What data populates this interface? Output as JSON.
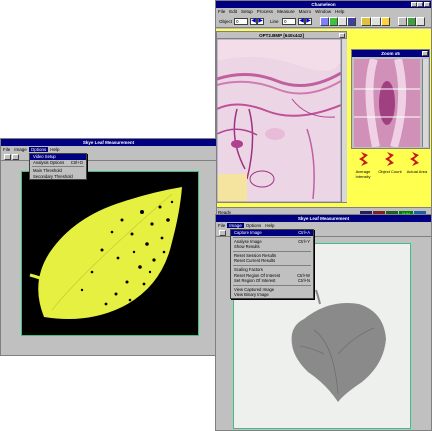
{
  "chameleon": {
    "title": "Chameleon",
    "menu": [
      "File",
      "Edit",
      "Setup",
      "Process",
      "Measure",
      "Macro",
      "Window",
      "Help"
    ],
    "toolbar": {
      "object_label": "Object",
      "object_value": "0",
      "line_label": "Line",
      "line_value": "0"
    },
    "image_window": {
      "title": "OPT2.BMP [640x442]"
    },
    "zoom_window": {
      "title": "Zoom x5"
    },
    "measures": [
      "Average Intensity",
      "Object Count",
      "Actual Area"
    ],
    "status": {
      "text": "Ready",
      "num": "NUM"
    }
  },
  "leaf_left": {
    "title": "Skye Leaf Measurement",
    "menu": [
      "File",
      "Image",
      "Options",
      "Help"
    ],
    "selected_menu": "Options",
    "options_menu": [
      {
        "label": "Video Setup",
        "shortcut": "",
        "selected": true
      },
      {
        "label": "Analysis Options",
        "shortcut": "Ctrl+O",
        "selected": false
      },
      {
        "sep": true
      },
      {
        "label": "Main Threshold",
        "shortcut": "",
        "selected": false
      },
      {
        "label": "Secondary Threshold",
        "shortcut": "",
        "selected": false
      }
    ]
  },
  "leaf_right": {
    "title": "Skye Leaf Measurement",
    "menu": [
      "File",
      "Image",
      "Options",
      "Help"
    ],
    "selected_menu": "Image",
    "image_menu": [
      {
        "label": "Capture Image",
        "shortcut": "Ctrl+A",
        "selected": true
      },
      {
        "sep": true
      },
      {
        "label": "Analyse Image",
        "shortcut": "Ctrl+Y",
        "selected": false
      },
      {
        "label": "Show Results",
        "shortcut": "",
        "selected": false
      },
      {
        "sep": true
      },
      {
        "label": "Reset Session Results",
        "shortcut": "",
        "selected": false
      },
      {
        "label": "Reset Current Results",
        "shortcut": "",
        "selected": false
      },
      {
        "sep": true
      },
      {
        "label": "Scaling Factors",
        "shortcut": "",
        "selected": false
      },
      {
        "label": "Reset Region Of Interest",
        "shortcut": "Ctrl+W",
        "selected": false
      },
      {
        "label": "Set Region Of Interest",
        "shortcut": "Ctrl+N",
        "selected": false
      },
      {
        "sep": true
      },
      {
        "label": "View Captured Image",
        "shortcut": "",
        "selected": false
      },
      {
        "label": "View Binary Image",
        "shortcut": "",
        "selected": false
      }
    ]
  },
  "colors": {
    "titlebar": "#000080",
    "face": "#c0c0c0",
    "leaf_yellow": "#e6f040",
    "leaf_gray": "#8a8a8a",
    "panel_yellow": "#ffff50",
    "arrow_red": "#c81818"
  }
}
